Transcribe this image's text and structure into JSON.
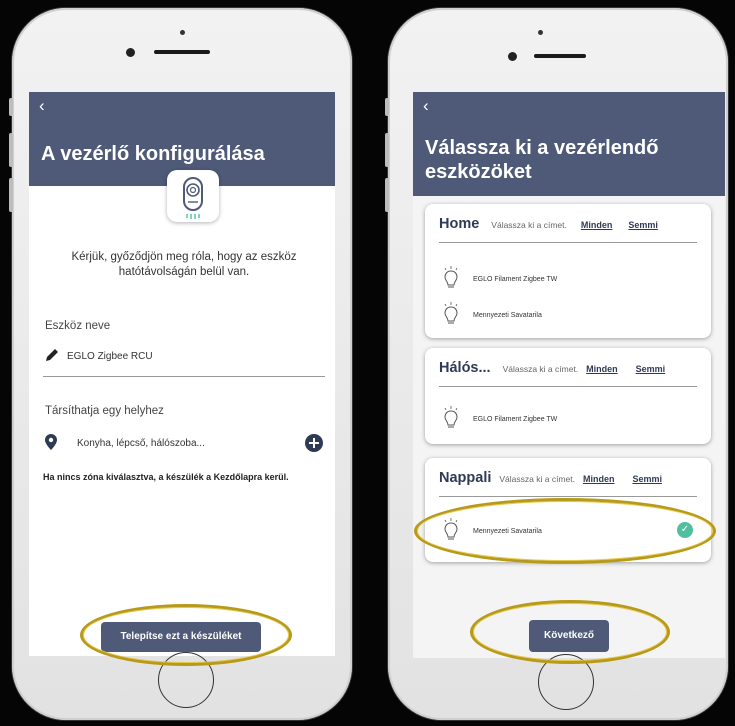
{
  "left_screen": {
    "back_icon": "chevron-left",
    "title": "A vezérlő konfigurálása",
    "instruction": "Kérjük, győződjön meg róla, hogy az eszköz hatótávolságán belül van.",
    "device_name_label": "Eszköz neve",
    "device_name_value": "EGLO Zigbee RCU",
    "location_label": "Társíthatja egy helyhez",
    "location_placeholder": "Konyha, lépcső, hálószoba...",
    "info_text": "Ha nincs zóna kiválasztva, a készülék a Kezdőlapra kerül.",
    "install_button": "Telepítse ezt a készüléket"
  },
  "right_screen": {
    "back_icon": "chevron-left",
    "title_line1": "Válassza ki a vezérlendő",
    "title_line2": "eszközöket",
    "groups": [
      {
        "name": "Home",
        "hint": "Válassza ki a címet.",
        "all_label": "Minden",
        "none_label": "Semmi",
        "devices": [
          "EGLO Filament Zigbee TW",
          "Mennyezeti Savatarila"
        ]
      },
      {
        "name": "Hálós...",
        "hint": "Válassza ki a címet.",
        "all_label": "Minden",
        "none_label": "Semmi",
        "devices": [
          "EGLO Filament Zigbee TW"
        ]
      },
      {
        "name": "Nappali",
        "hint": "Válassza ki a címet.",
        "all_label": "Minden",
        "none_label": "Semmi",
        "devices": [
          "Mennyezeti Savatarila"
        ],
        "selected": [
          true
        ]
      }
    ],
    "next_button": "Következő"
  },
  "colors": {
    "navbar": "#4e5a78",
    "check": "#4fbf9f",
    "annotation": "#b89a1a",
    "background": "#050505"
  }
}
